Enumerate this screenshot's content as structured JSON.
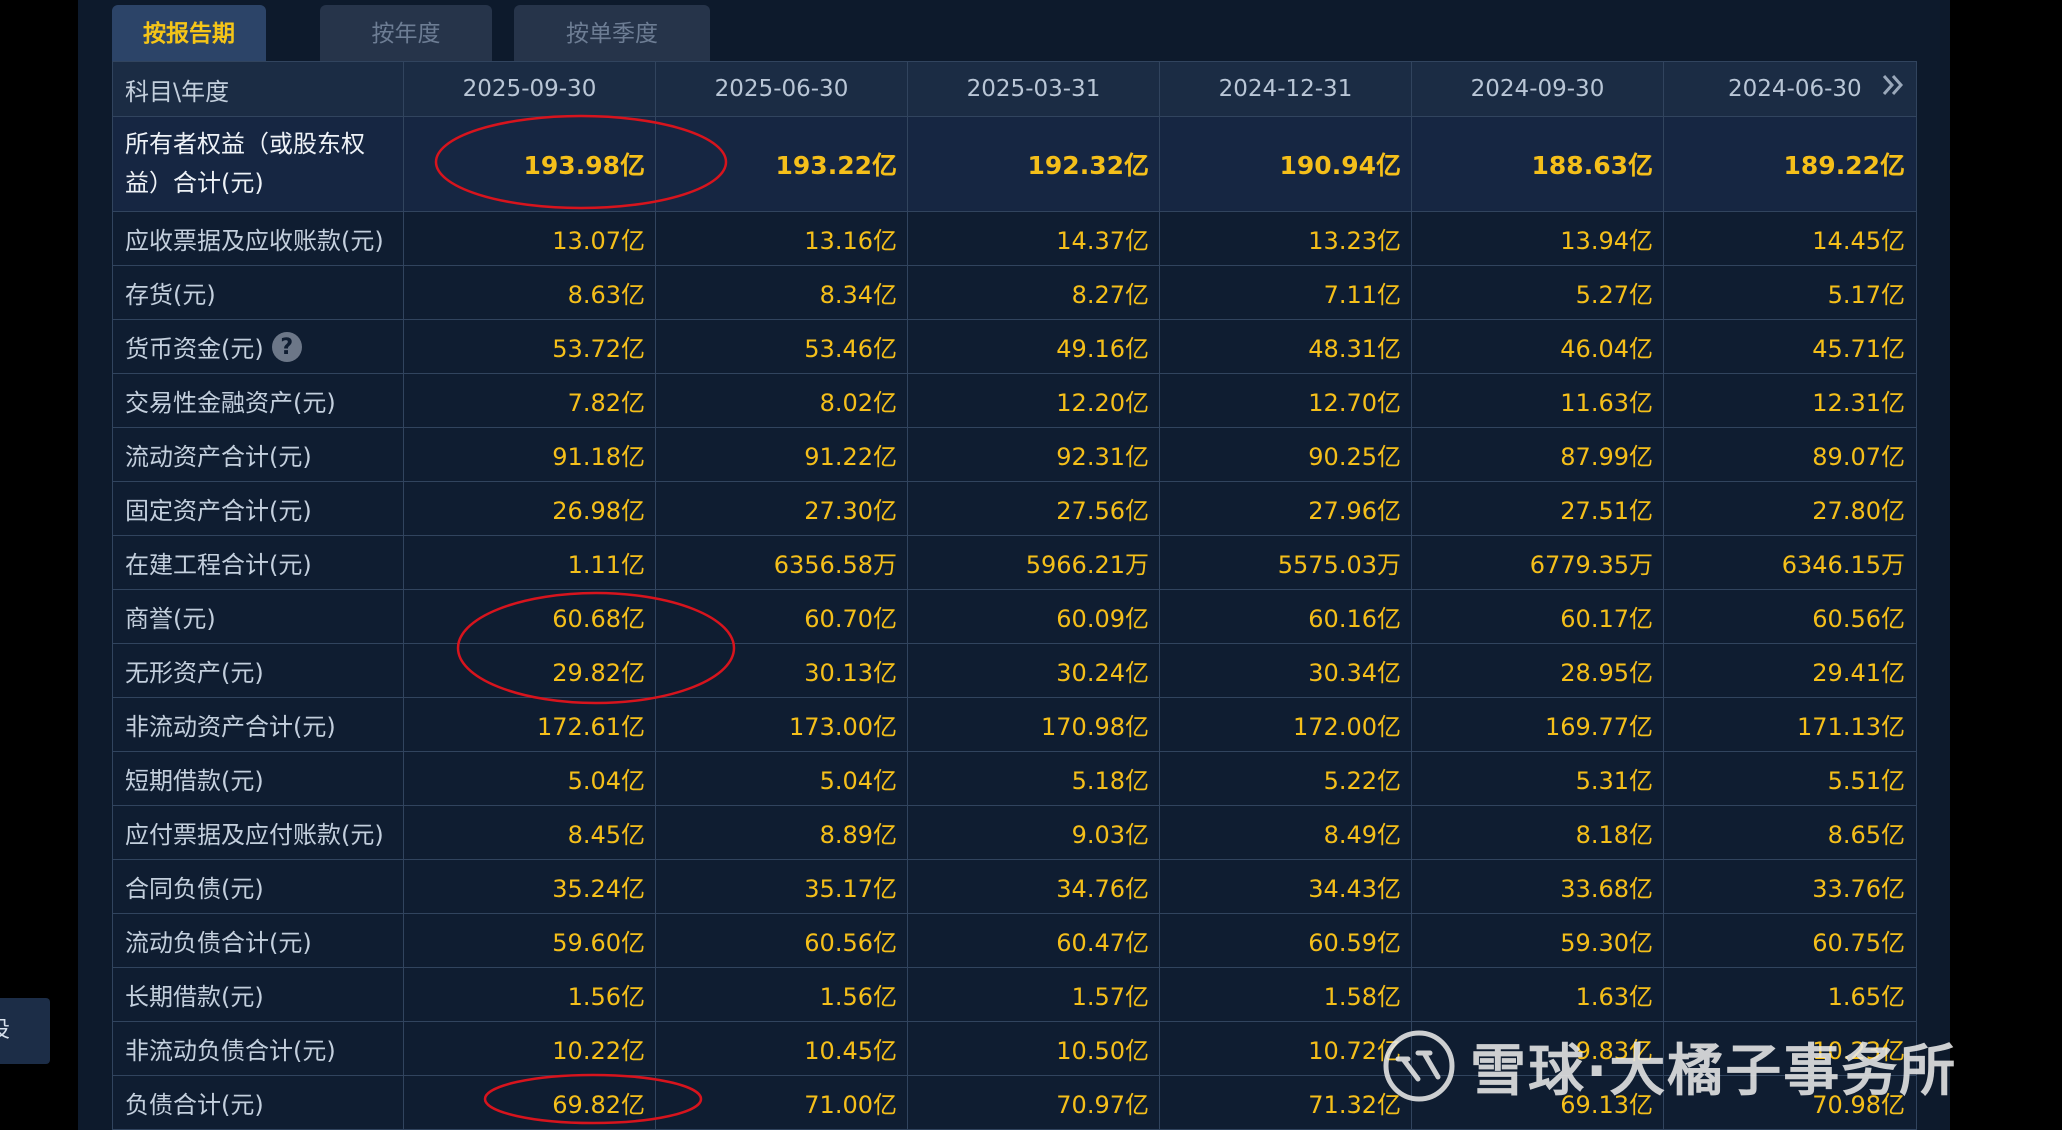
{
  "tabs": [
    {
      "label": "按报告期",
      "active": true
    },
    {
      "label": "按年度",
      "active": false
    },
    {
      "label": "按单季度",
      "active": false
    }
  ],
  "table": {
    "corner_label": "科目\\年度",
    "columns": [
      "2025-09-30",
      "2025-06-30",
      "2025-03-31",
      "2024-12-31",
      "2024-09-30",
      "2024-06-30"
    ],
    "equity": {
      "label": "所有者权益（或股东权益）合计(元)",
      "values": [
        "193.98亿",
        "193.22亿",
        "192.32亿",
        "190.94亿",
        "188.63亿",
        "189.22亿"
      ]
    },
    "rows": [
      {
        "label": "应收票据及应收账款(元)",
        "values": [
          "13.07亿",
          "13.16亿",
          "14.37亿",
          "13.23亿",
          "13.94亿",
          "14.45亿"
        ]
      },
      {
        "label": "存货(元)",
        "values": [
          "8.63亿",
          "8.34亿",
          "8.27亿",
          "7.11亿",
          "5.27亿",
          "5.17亿"
        ]
      },
      {
        "label": "货币资金(元)",
        "help": true,
        "values": [
          "53.72亿",
          "53.46亿",
          "49.16亿",
          "48.31亿",
          "46.04亿",
          "45.71亿"
        ]
      },
      {
        "label": "交易性金融资产(元)",
        "values": [
          "7.82亿",
          "8.02亿",
          "12.20亿",
          "12.70亿",
          "11.63亿",
          "12.31亿"
        ]
      },
      {
        "label": "流动资产合计(元)",
        "values": [
          "91.18亿",
          "91.22亿",
          "92.31亿",
          "90.25亿",
          "87.99亿",
          "89.07亿"
        ]
      },
      {
        "label": "固定资产合计(元)",
        "values": [
          "26.98亿",
          "27.30亿",
          "27.56亿",
          "27.96亿",
          "27.51亿",
          "27.80亿"
        ]
      },
      {
        "label": "在建工程合计(元)",
        "values": [
          "1.11亿",
          "6356.58万",
          "5966.21万",
          "5575.03万",
          "6779.35万",
          "6346.15万"
        ]
      },
      {
        "label": "商誉(元)",
        "values": [
          "60.68亿",
          "60.70亿",
          "60.09亿",
          "60.16亿",
          "60.17亿",
          "60.56亿"
        ]
      },
      {
        "label": "无形资产(元)",
        "values": [
          "29.82亿",
          "30.13亿",
          "30.24亿",
          "30.34亿",
          "28.95亿",
          "29.41亿"
        ]
      },
      {
        "label": "非流动资产合计(元)",
        "values": [
          "172.61亿",
          "173.00亿",
          "170.98亿",
          "172.00亿",
          "169.77亿",
          "171.13亿"
        ]
      },
      {
        "label": "短期借款(元)",
        "values": [
          "5.04亿",
          "5.04亿",
          "5.18亿",
          "5.22亿",
          "5.31亿",
          "5.51亿"
        ]
      },
      {
        "label": "应付票据及应付账款(元)",
        "values": [
          "8.45亿",
          "8.89亿",
          "9.03亿",
          "8.49亿",
          "8.18亿",
          "8.65亿"
        ]
      },
      {
        "label": "合同负债(元)",
        "values": [
          "35.24亿",
          "35.17亿",
          "34.76亿",
          "34.43亿",
          "33.68亿",
          "33.76亿"
        ]
      },
      {
        "label": "流动负债合计(元)",
        "values": [
          "59.60亿",
          "60.56亿",
          "60.47亿",
          "60.59亿",
          "59.30亿",
          "60.75亿"
        ]
      },
      {
        "label": "长期借款(元)",
        "values": [
          "1.56亿",
          "1.56亿",
          "1.57亿",
          "1.58亿",
          "1.63亿",
          "1.65亿"
        ]
      },
      {
        "label": "非流动负债合计(元)",
        "values": [
          "10.22亿",
          "10.45亿",
          "10.50亿",
          "10.72亿",
          "9.83亿",
          "10.23亿"
        ]
      },
      {
        "label": "负债合计(元)",
        "values": [
          "69.82亿",
          "71.00亿",
          "70.97亿",
          "71.32亿",
          "69.13亿",
          "70.98亿"
        ]
      }
    ]
  },
  "side_tab": {
    "label": "投"
  },
  "watermark": {
    "text": "雪球·大橘子事务所"
  },
  "icons": {
    "help": "question-circle-icon",
    "next": "double-chevron-right-icon",
    "logo": "xueqiu-logo-icon"
  },
  "colors": {
    "value": "#f5bf1a",
    "active_tab": "#f5c518",
    "annotation": "#d7141d"
  }
}
